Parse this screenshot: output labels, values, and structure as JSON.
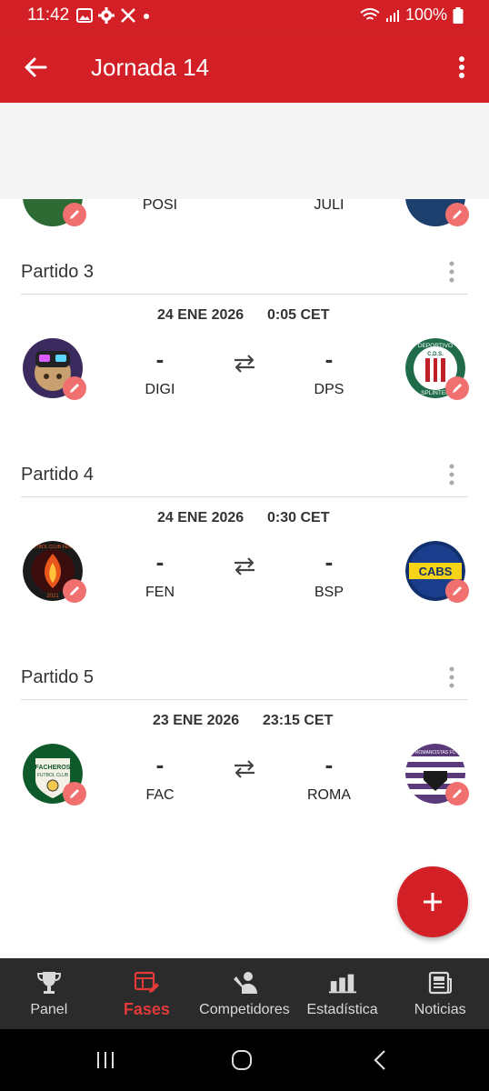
{
  "status_bar": {
    "time": "11:42",
    "battery": "100%"
  },
  "app_bar": {
    "title": "Jornada 14"
  },
  "partial_row": {
    "home_abbr": "POSI",
    "away_abbr": "JULI"
  },
  "matches": [
    {
      "title": "Partido 3",
      "date": "24 ENE 2026",
      "time": "0:05 CET",
      "home_score": "-",
      "away_score": "-",
      "home_abbr": "DIGI",
      "away_abbr": "DPS"
    },
    {
      "title": "Partido 4",
      "date": "24 ENE 2026",
      "time": "0:30 CET",
      "home_score": "-",
      "away_score": "-",
      "home_abbr": "FEN",
      "away_abbr": "BSP"
    },
    {
      "title": "Partido 5",
      "date": "23 ENE 2026",
      "time": "23:15 CET",
      "home_score": "-",
      "away_score": "-",
      "home_abbr": "FAC",
      "away_abbr": "ROMA"
    }
  ],
  "logo_text": {
    "dps_top": "DEPORTIVO",
    "dps_mid": "C.D.S.",
    "dps_bottom": "SPLINTER",
    "fen_ring": "FUTBOL CLUB FENIX",
    "fen_year": "2021",
    "bsp": "CABS",
    "fac_main": "FACHEROS",
    "fac_sub": "FUTBOL CLUB",
    "roma": "ROMANCISTAS FC"
  },
  "bottom_nav": [
    {
      "label": "Panel",
      "icon": "trophy-icon",
      "active": false
    },
    {
      "label": "Fases",
      "icon": "bracket-edit-icon",
      "active": true
    },
    {
      "label": "Competidores",
      "icon": "players-icon",
      "active": false
    },
    {
      "label": "Estadística",
      "icon": "bar-chart-icon",
      "active": false
    },
    {
      "label": "Noticias",
      "icon": "newspaper-icon",
      "active": false
    }
  ],
  "colors": {
    "primary": "#d32027",
    "edit_badge": "#f07070",
    "nav_bg": "#2b2b2b",
    "nav_active": "#e23a3a"
  }
}
